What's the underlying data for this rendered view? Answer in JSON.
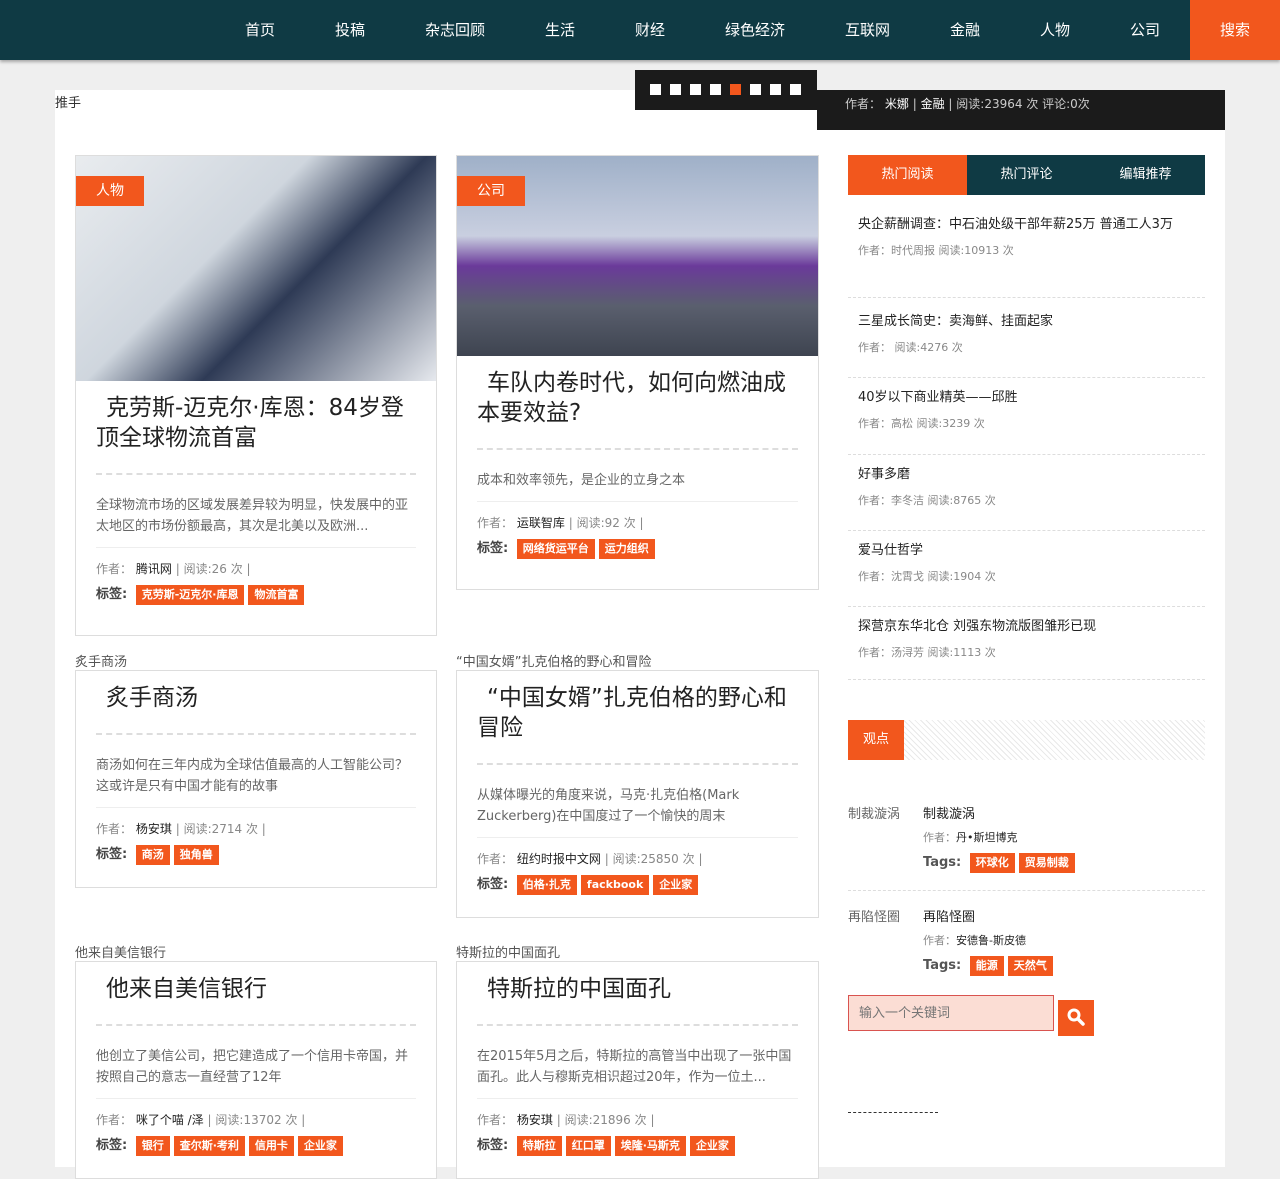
{
  "nav": {
    "items": [
      "首页",
      "投稿",
      "杂志回顾",
      "生活",
      "财经",
      "绿色经济",
      "互联网",
      "金融",
      "人物",
      "公司"
    ],
    "search": "搜索"
  },
  "section_label": "推手",
  "slider": {
    "count": 8,
    "active": 5
  },
  "featured_info": {
    "author_label": "作者：",
    "author": "米娜",
    "category": "金融",
    "stats": "阅读:23964 次 评论:0次"
  },
  "labels": {
    "author": "作者：",
    "tags": "标签:",
    "sep": "|"
  },
  "articles": [
    {
      "section": "",
      "category": "人物",
      "title": "克劳斯-迈克尔·库恩：84岁登顶全球物流首富",
      "desc": "全球物流市场的区域发展差异较为明显，快发展中的亚太地区的市场份额最高，其次是北美以及欧洲...",
      "author": "腾讯网",
      "reads": "阅读:26 次",
      "tags": [
        "克劳斯-迈克尔·库恩",
        "物流首富"
      ]
    },
    {
      "section": "",
      "category": "公司",
      "title": "车队内卷时代，如何向燃油成本要效益?",
      "desc": "成本和效率领先，是企业的立身之本",
      "author": "运联智库",
      "reads": "阅读:92 次",
      "tags": [
        "网络货运平台",
        "运力组织"
      ]
    },
    {
      "section": "炙手商汤",
      "title": "炙手商汤",
      "desc": "商汤如何在三年内成为全球估值最高的人工智能公司？这或许是只有中国才能有的故事",
      "author": "杨安琪",
      "reads": "阅读:2714 次",
      "tags": [
        "商汤",
        "独角兽"
      ]
    },
    {
      "section": "“中国女婿”扎克伯格的野心和冒险",
      "title": "“中国女婿”扎克伯格的野心和冒险",
      "desc": "从媒体曝光的角度来说，马克·扎克伯格(Mark Zuckerberg)在中国度过了一个愉快的周末",
      "author": "纽约时报中文网",
      "reads": "阅读:25850 次",
      "tags": [
        "伯格·扎克",
        "fackbook",
        "企业家"
      ]
    },
    {
      "section": "他来自美信银行",
      "title": "他来自美信银行",
      "desc": "他创立了美信公司，把它建造成了一个信用卡帝国，并按照自己的意志一直经营了12年",
      "author": "咪了个喵 /泽",
      "reads": "阅读:13702 次",
      "tags": [
        "银行",
        "查尔斯·考利",
        "信用卡",
        "企业家"
      ]
    },
    {
      "section": "特斯拉的中国面孔",
      "title": "特斯拉的中国面孔",
      "desc": "在2015年5月之后，特斯拉的高管当中出现了一张中国面孔。此人与穆斯克相识超过20年，作为一位土...",
      "author": "杨安琪",
      "reads": "阅读:21896 次",
      "tags": [
        "特斯拉",
        "红口罩",
        "埃隆·马斯克",
        "企业家"
      ]
    }
  ],
  "sidebar": {
    "tabs": [
      "热门阅读",
      "热门评论",
      "编辑推荐"
    ],
    "hot": [
      {
        "title": "央企薪酬调查：中石油处级干部年薪25万 普通工人3万",
        "meta": "作者：时代周报 阅读:10913 次"
      },
      {
        "title": "三星成长简史：卖海鲜、挂面起家",
        "meta": "作者： 阅读:4276 次"
      },
      {
        "title": "40岁以下商业精英——邱胜",
        "meta": "作者：高松 阅读:3239 次"
      },
      {
        "title": "好事多磨",
        "meta": "作者：李冬洁 阅读:8765 次"
      },
      {
        "title": "爱马仕哲学",
        "meta": "作者：沈霄戈 阅读:1904 次"
      },
      {
        "title": "探营京东华北仓 刘强东物流版图雏形已现",
        "meta": "作者：汤浔芳 阅读:1113 次"
      }
    ],
    "view_title": "观点",
    "tags_label": "Tags:",
    "opinions": [
      {
        "label": "制裁漩涡",
        "title": "制裁漩涡",
        "author": "丹•斯坦博克",
        "tags": [
          "环球化",
          "贸易制裁"
        ]
      },
      {
        "label": "再陷怪圈",
        "title": "再陷怪圈",
        "author": "安德鲁-斯皮德",
        "tags": [
          "能源",
          "天然气"
        ]
      }
    ],
    "search_placeholder": "输入一个关键词"
  }
}
